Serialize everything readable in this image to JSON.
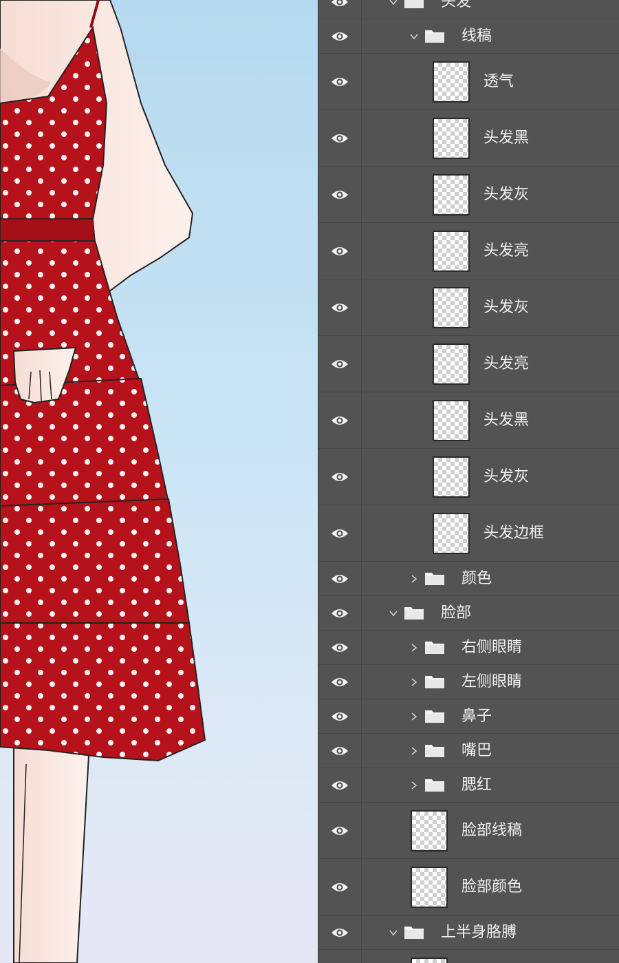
{
  "colors": {
    "panel_bg": "#535353",
    "row_divider": "#474747",
    "text": "#f0f0f0",
    "dress_red": "#b5121b",
    "skin": "#fbe9e3"
  },
  "layers_panel": {
    "rows": [
      {
        "type": "group",
        "label": "头发",
        "expanded": true,
        "indent": 0
      },
      {
        "type": "group",
        "label": "线稿",
        "expanded": true,
        "indent": 1
      },
      {
        "type": "layer",
        "label": "透气",
        "indent": 2
      },
      {
        "type": "layer",
        "label": "头发黑",
        "indent": 2
      },
      {
        "type": "layer",
        "label": "头发灰",
        "indent": 2
      },
      {
        "type": "layer",
        "label": "头发亮",
        "indent": 2
      },
      {
        "type": "layer",
        "label": "头发灰",
        "indent": 2
      },
      {
        "type": "layer",
        "label": "头发亮",
        "indent": 2
      },
      {
        "type": "layer",
        "label": "头发黑",
        "indent": 2
      },
      {
        "type": "layer",
        "label": "头发灰",
        "indent": 2
      },
      {
        "type": "layer",
        "label": "头发边框",
        "indent": 2
      },
      {
        "type": "group",
        "label": "颜色",
        "expanded": false,
        "indent": 1
      },
      {
        "type": "group",
        "label": "脸部",
        "expanded": true,
        "indent": 0
      },
      {
        "type": "group",
        "label": "右侧眼睛",
        "expanded": false,
        "indent": 1
      },
      {
        "type": "group",
        "label": "左侧眼睛",
        "expanded": false,
        "indent": 1
      },
      {
        "type": "group",
        "label": "鼻子",
        "expanded": false,
        "indent": 1
      },
      {
        "type": "group",
        "label": "嘴巴",
        "expanded": false,
        "indent": 1
      },
      {
        "type": "group",
        "label": "腮红",
        "expanded": false,
        "indent": 1
      },
      {
        "type": "layer",
        "label": "脸部线稿",
        "indent": 1
      },
      {
        "type": "layer",
        "label": "脸部颜色",
        "indent": 1
      },
      {
        "type": "group",
        "label": "上半身胳膊",
        "expanded": true,
        "indent": 0
      },
      {
        "type": "layer",
        "label": "",
        "indent": 1
      }
    ]
  }
}
